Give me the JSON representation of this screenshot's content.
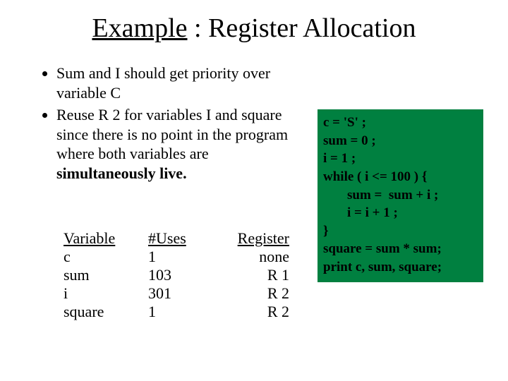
{
  "title": {
    "example_label": "Example",
    "colon": " : ",
    "topic": "Register Allocation"
  },
  "bullets": {
    "b1": "Sum and I should get priority over variable C",
    "b2_pre": "Reuse R 2 for variables I and square since there is no point in the program where both variables are ",
    "b2_bold": "simultaneously live."
  },
  "table": {
    "headers": {
      "variable": "Variable",
      "uses": "#Uses",
      "register": "Register"
    },
    "rows": [
      {
        "variable": "c",
        "uses": "1",
        "register": "none"
      },
      {
        "variable": "sum",
        "uses": "103",
        "register": "R 1"
      },
      {
        "variable": "i",
        "uses": "301",
        "register": "R 2"
      },
      {
        "variable": "square",
        "uses": "1",
        "register": "R 2"
      }
    ]
  },
  "code": {
    "l1": "c = 'S' ;",
    "l2": "sum = 0 ;",
    "l3": "i = 1 ;",
    "l4": "while ( i <= 100 ) {",
    "l5": "sum =  sum + i ;",
    "l6": "i = i + 1 ;",
    "l7": "}",
    "l8": "square = sum * sum;",
    "l9": "print c, sum, square;"
  }
}
